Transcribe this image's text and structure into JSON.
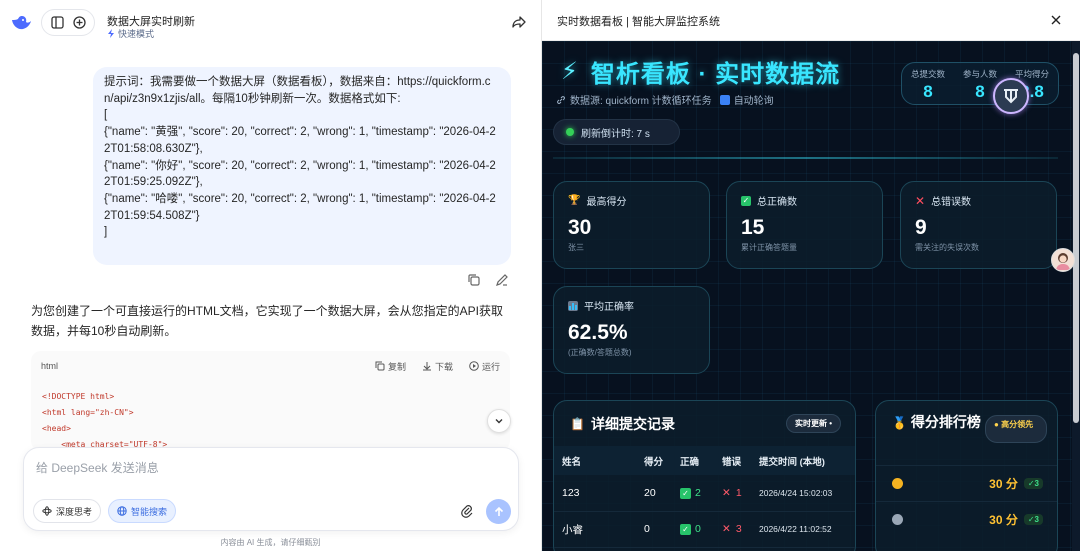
{
  "chat": {
    "title": "数据大屏实时刷新",
    "mode": "快速模式",
    "user_message": "提示词：我需要做一个数据大屏（数据看板），数据来自：https://quickform.cn/api/z3n9x1zjis/all。每隔10秒钟刷新一次。数据格式如下:\n[\n{\"name\": \"黄强\", \"score\": 20, \"correct\": 2, \"wrong\": 1, \"timestamp\": \"2026-04-22T01:58:08.630Z\"},\n{\"name\": \"你好\", \"score\": 20, \"correct\": 2, \"wrong\": 1, \"timestamp\": \"2026-04-22T01:59:25.092Z\"},\n{\"name\": \"哈喽\", \"score\": 20, \"correct\": 2, \"wrong\": 1, \"timestamp\": \"2026-04-22T01:59:54.508Z\"}\n]",
    "ai_reply": "为您创建了一个可直接运行的HTML文档，它实现了一个数据大屏，会从您指定的API获取数据，并每10秒自动刷新。",
    "code": {
      "lang": "html",
      "copy_label": "复制",
      "download_label": "下载",
      "run_label": "运行",
      "lines": [
        "<!DOCTYPE html>",
        "<html lang=\"zh-CN\">",
        "<head>",
        "    <meta charset=\"UTF-8\">"
      ]
    },
    "input_placeholder": "给 DeepSeek 发送消息",
    "deep_think_label": "深度思考",
    "smart_search_label": "智能搜索",
    "footer_note": "内容由 AI 生成，请仔细甄别"
  },
  "preview": {
    "title": "实时数据看板 | 智能大屏监控系统"
  },
  "dashboard": {
    "title": "智析看板 · 实时数据流",
    "source_text": "数据源: quickform 计数循环任务",
    "auto_text": "自动轮询",
    "stats": [
      {
        "label": "总提交数",
        "value": "8"
      },
      {
        "label": "参与人数",
        "value": "8"
      },
      {
        "label": "平均得分",
        "value": "2.8"
      }
    ],
    "countdown": "刷新倒计时: 7 s",
    "cards": [
      {
        "icon": "trophy-icon",
        "label": "最高得分",
        "value": "30",
        "caption": "张三"
      },
      {
        "icon": "check-icon",
        "label": "总正确数",
        "value": "15",
        "caption": "累计正确答题量"
      },
      {
        "icon": "cross-icon",
        "label": "总错误数",
        "value": "9",
        "caption": "需关注的失误次数"
      },
      {
        "icon": "chart-icon",
        "label": "平均正确率",
        "value": "62.5%",
        "caption": "(正确数/答题总数)"
      }
    ],
    "records": {
      "title": "详细提交记录",
      "badge": "实时更新",
      "headers": [
        "姓名",
        "得分",
        "正确",
        "错误",
        "提交时间 (本地)"
      ],
      "rows": [
        {
          "name": "123",
          "score": "20",
          "correct": "2",
          "wrong": "1",
          "time": "2026/4/24 15:02:03"
        },
        {
          "name": "小睿",
          "score": "0",
          "correct": "0",
          "wrong": "3",
          "time": "2026/4/22 11:02:52"
        }
      ]
    },
    "ranking": {
      "title": "得分排行榜",
      "badge": "高分领先",
      "rows": [
        {
          "medal": "gold",
          "score": "30 分",
          "check": "✓3"
        },
        {
          "medal": "silver",
          "score": "30 分",
          "check": "✓3"
        }
      ]
    }
  },
  "colors": {
    "accent": "#39e6ff",
    "dashboard_bg": "#07111f",
    "success": "#27c36a",
    "danger": "#ff5a6a",
    "gold": "#ffc233"
  }
}
